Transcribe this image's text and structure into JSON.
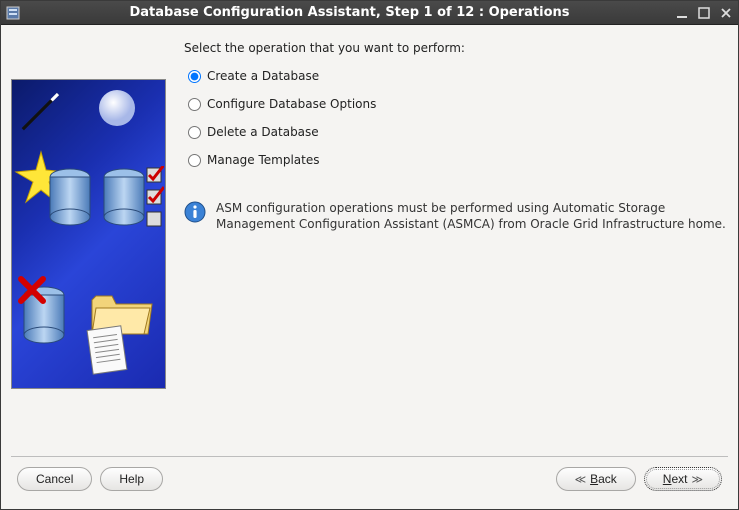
{
  "titlebar": {
    "title": "Database Configuration Assistant, Step 1 of 12 : Operations"
  },
  "main": {
    "prompt": "Select the operation that you want to perform:",
    "options": {
      "create": "Create a Database",
      "configure": "Configure Database Options",
      "delete": "Delete a Database",
      "templates": "Manage Templates"
    },
    "selected": "create",
    "info_text": "ASM configuration operations must be performed using Automatic Storage Management Configuration Assistant (ASMCA) from Oracle Grid Infrastructure home."
  },
  "footer": {
    "cancel": "Cancel",
    "help": "Help",
    "back_letter": "B",
    "back_rest": "ack",
    "next_letter": "N",
    "next_rest": "ext"
  }
}
